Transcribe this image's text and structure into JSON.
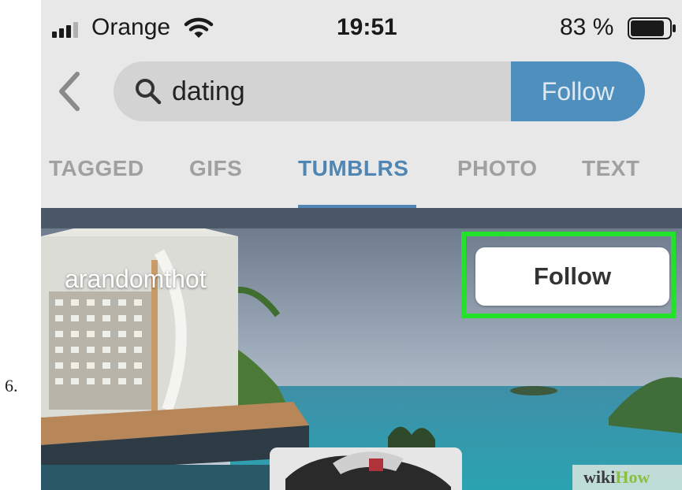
{
  "step": {
    "number": "6."
  },
  "status_bar": {
    "carrier": "Orange",
    "time": "19:51",
    "battery_percent": "83 %",
    "icons": [
      "signal-icon",
      "wifi-icon",
      "battery-icon"
    ]
  },
  "search": {
    "query": "dating",
    "follow_label": "Follow",
    "icons": [
      "back-chevron-icon",
      "search-icon"
    ]
  },
  "tabs": [
    {
      "label": "TAGGED",
      "active": false
    },
    {
      "label": "GIFS",
      "active": false
    },
    {
      "label": "TUMBLRS",
      "active": true
    },
    {
      "label": "PHOTO",
      "active": false
    },
    {
      "label": "TEXT",
      "active": false
    }
  ],
  "blog_card": {
    "blog_name": "arandomthot",
    "follow_label": "Follow",
    "highlight_color": "#22e22a"
  },
  "watermark": {
    "part1": "wiki",
    "part2": "How"
  },
  "colors": {
    "accent": "#4f86b4",
    "follow_button": "#4f8fbd",
    "background": "#e8e8e8"
  }
}
